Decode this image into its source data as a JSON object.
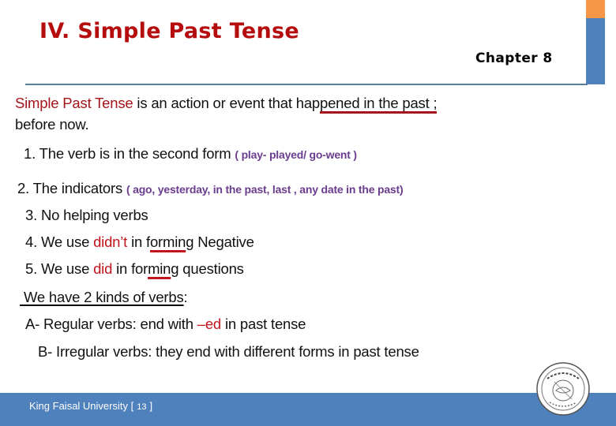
{
  "colors": {
    "title": "#b50d0d",
    "accent_orange": "#f79646",
    "accent_blue": "#4f81bd",
    "footer_bg": "#4f81bd",
    "divider": "#5b7d96",
    "highlight_red": "#c0151a",
    "example_purple": "#6a3d8f"
  },
  "header": {
    "title": "IV. Simple Past Tense",
    "chapter": "Chapter 8"
  },
  "content": {
    "definition": {
      "term": "Simple Past Tense",
      "text_pre": " is an action or event that hap",
      "text_underlined": "pened in the past ;",
      "text_line2": "before now."
    },
    "rules": [
      {
        "text": "1. The verb is in the second form ",
        "example": "( play- played/ go-went )"
      },
      {
        "text": "2.  The indicators ",
        "example": "( ago, yesterday, in the past, last , any date in the past)"
      },
      {
        "text": "3. No helping verbs"
      },
      {
        "pre": "4. We use ",
        "highlight": "didn’t",
        "mid": " in f",
        "underlined": "ormin",
        "post": "g Negative"
      },
      {
        "pre": "5. We use ",
        "highlight": "did",
        "mid": " in for",
        "underlined": "min",
        "post": "g questions"
      }
    ],
    "kinds_heading": "We have 2 kinds of verbs",
    "kinds_colon": ":",
    "kinds": [
      {
        "pre": "A- Regular verbs: end with ",
        "highlight": "–ed",
        "post": " in past tense"
      },
      {
        "text": "B- Irregular verbs: they end with different forms in past tense"
      }
    ]
  },
  "footer": {
    "institution": "King Faisal University",
    "page_open": "[",
    "page_number": "13",
    "page_close": "]",
    "logo": "university-seal-logo"
  }
}
